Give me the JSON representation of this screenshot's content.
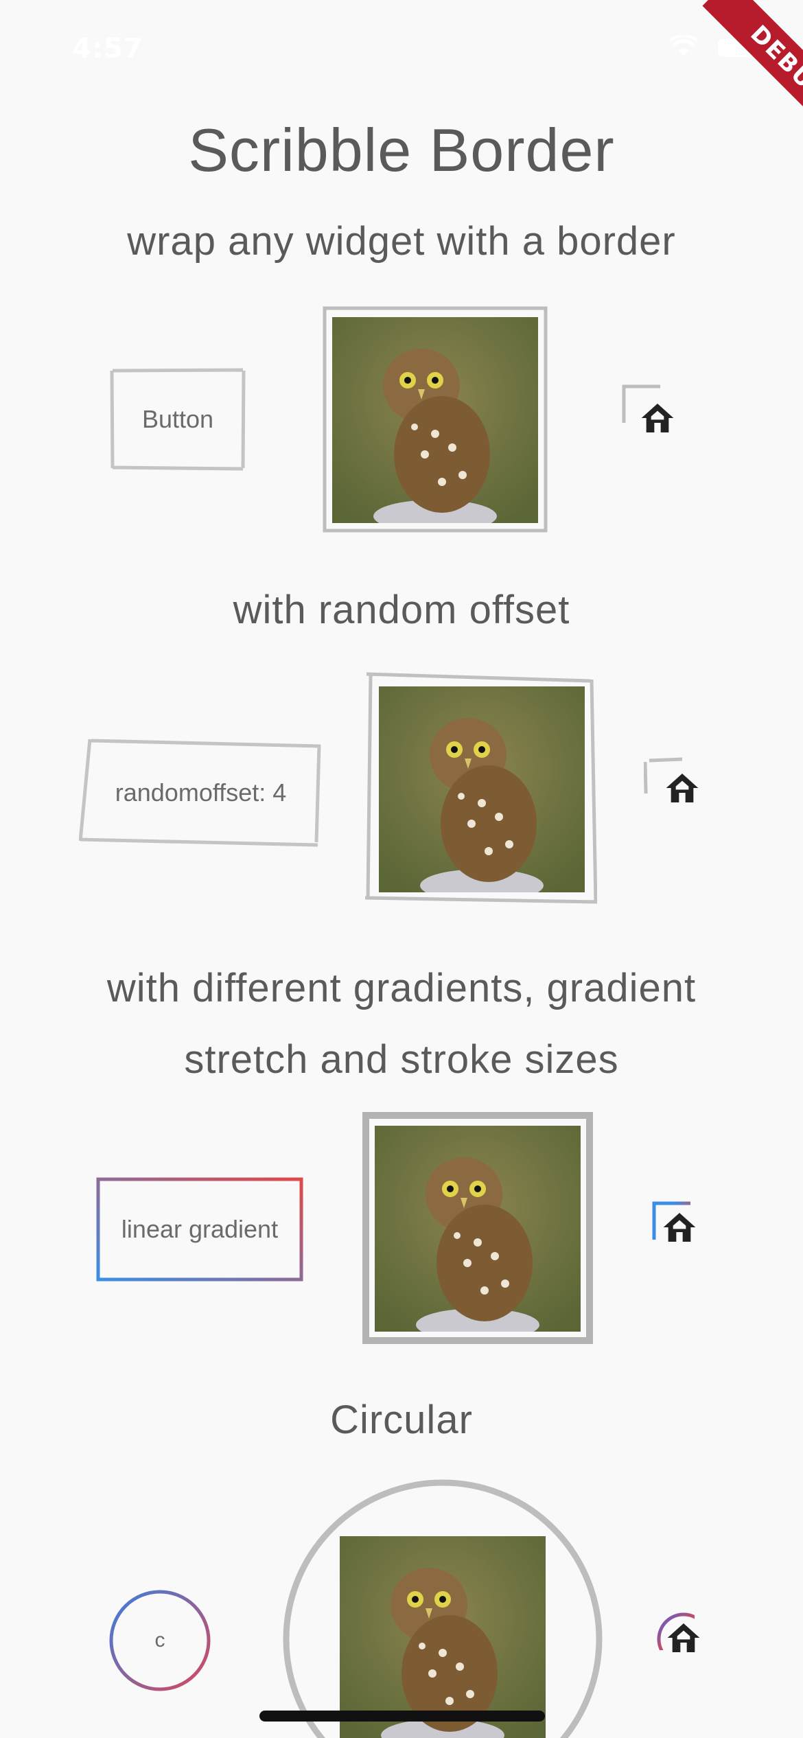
{
  "status_bar": {
    "time": "4:57"
  },
  "debug_label": "DEBUG",
  "title": "Scribble Border",
  "sections": [
    {
      "heading": "wrap any widget with a border",
      "button_label": "Button"
    },
    {
      "heading": "with random offset",
      "button_label": "randomoffset: 4"
    },
    {
      "heading": "with different gradients, gradient stretch and stroke sizes",
      "button_label": "linear gradient"
    },
    {
      "heading": "Circular",
      "button_label": "c"
    }
  ],
  "icons": {
    "home": "home-icon",
    "photo": "owl-image"
  },
  "colors": {
    "background": "#f9f9f9",
    "border_gray": "#bdbdbd",
    "gradient_blue": "#3a8ee6",
    "gradient_red": "#e04848",
    "debug_red": "#b71c2c"
  }
}
